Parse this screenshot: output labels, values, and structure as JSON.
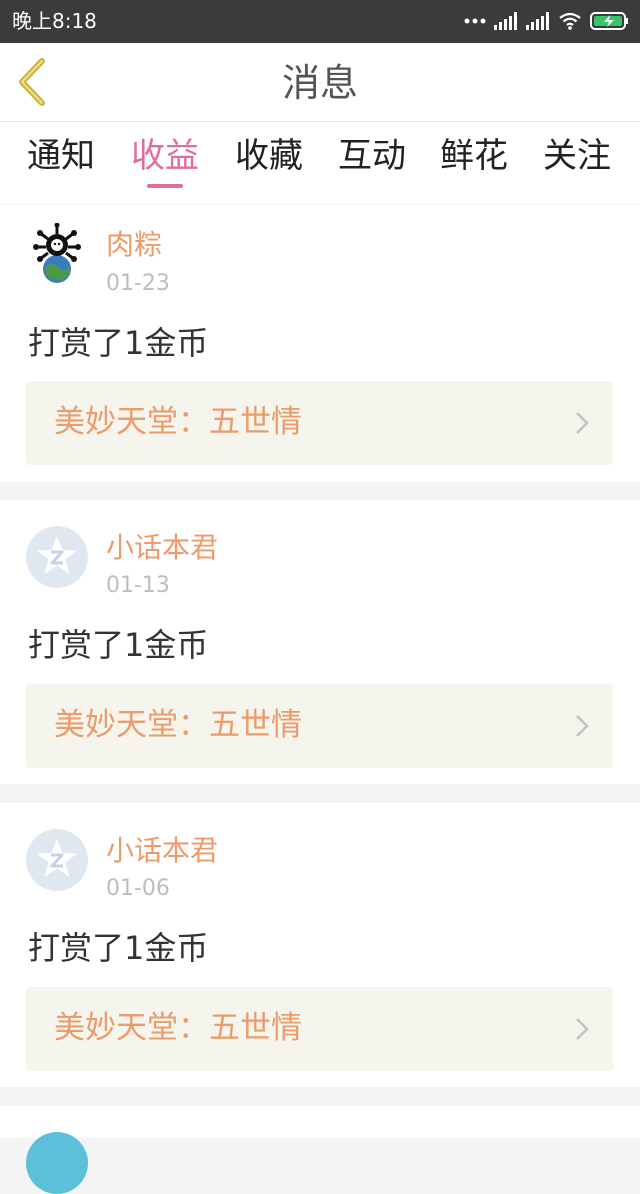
{
  "status_bar": {
    "time": "晚上8:18"
  },
  "header": {
    "title": "消息"
  },
  "tabs": [
    {
      "label": "通知"
    },
    {
      "label": "收益"
    },
    {
      "label": "收藏"
    },
    {
      "label": "互动"
    },
    {
      "label": "鲜花"
    },
    {
      "label": "关注"
    }
  ],
  "active_tab": "收益",
  "messages": [
    {
      "user": "肉粽",
      "date": "01-23",
      "action": "打赏了1金币",
      "work_title": "美妙天堂：五世情"
    },
    {
      "user": "小话本君",
      "date": "01-13",
      "action": "打赏了1金币",
      "work_title": "美妙天堂：五世情"
    },
    {
      "user": "小话本君",
      "date": "01-06",
      "action": "打赏了1金币",
      "work_title": "美妙天堂：五世情"
    }
  ],
  "colors": {
    "accent_pink": "#e06e9d",
    "username_orange": "#ec9b6a",
    "work_card_bg": "#f5f5ee"
  }
}
